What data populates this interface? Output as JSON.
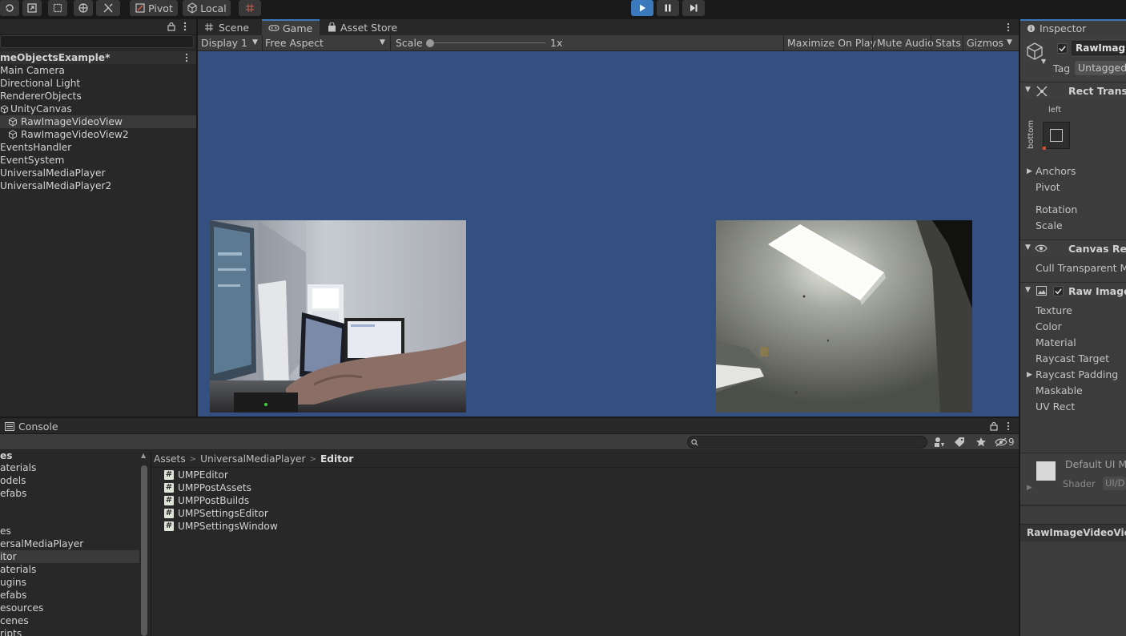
{
  "toolbar": {
    "pivot_label": "Pivot",
    "local_label": "Local"
  },
  "hierarchy": {
    "scene_name": "meObjectsExample*",
    "items": [
      "Main Camera",
      "Directional Light",
      "RendererObjects",
      "UnityCanvas",
      "RawImageVideoView",
      "RawImageVideoView2",
      "EventsHandler",
      "EventSystem",
      "UniversalMediaPlayer",
      "UniversalMediaPlayer2"
    ]
  },
  "tabs": {
    "scene": "Scene",
    "game": "Game",
    "asset_store": "Asset Store"
  },
  "gamebar": {
    "display": "Display 1",
    "aspect": "Free Aspect",
    "scale_label": "Scale",
    "scale_value": "1x",
    "maximize": "Maximize On Play",
    "mute": "Mute Audio",
    "stats": "Stats",
    "gizmos": "Gizmos"
  },
  "inspector": {
    "title": "Inspector",
    "object_name": "RawImageV",
    "tag_label": "Tag",
    "tag_value": "Untagged",
    "rect_transform": "Rect Transfo",
    "anchor_left": "left",
    "anchor_bottom": "bottom",
    "anchors": "Anchors",
    "pivot": "Pivot",
    "rotation": "Rotation",
    "scale": "Scale",
    "canvas_renderer": "Canvas Rend",
    "cull": "Cull Transparent Me",
    "raw_image": "Raw Image",
    "texture": "Texture",
    "color": "Color",
    "material": "Material",
    "raycast_target": "Raycast Target",
    "raycast_padding": "Raycast Padding",
    "maskable": "Maskable",
    "uv_rect": "UV Rect",
    "default_ui": "Default UI M",
    "shader_label": "Shader",
    "shader_value": "UI/D",
    "footer_name": "RawImageVideoView"
  },
  "console": {
    "tab": "Console",
    "hidden_count": "9"
  },
  "project": {
    "left_items": [
      "es",
      "aterials",
      "odels",
      "efabs",
      "",
      "es",
      "ersalMediaPlayer",
      "itor",
      "aterials",
      "ugins",
      "efabs",
      "esources",
      "cenes",
      "ripts"
    ],
    "breadcrumb": [
      "Assets",
      "UniversalMediaPlayer",
      "Editor"
    ],
    "files": [
      "UMPEditor",
      "UMPPostAssets",
      "UMPPostBuilds",
      "UMPSettingsEditor",
      "UMPSettingsWindow"
    ]
  },
  "colors": {
    "game_bg": "#335080",
    "accent": "#3a79bb",
    "panel": "#282828"
  }
}
